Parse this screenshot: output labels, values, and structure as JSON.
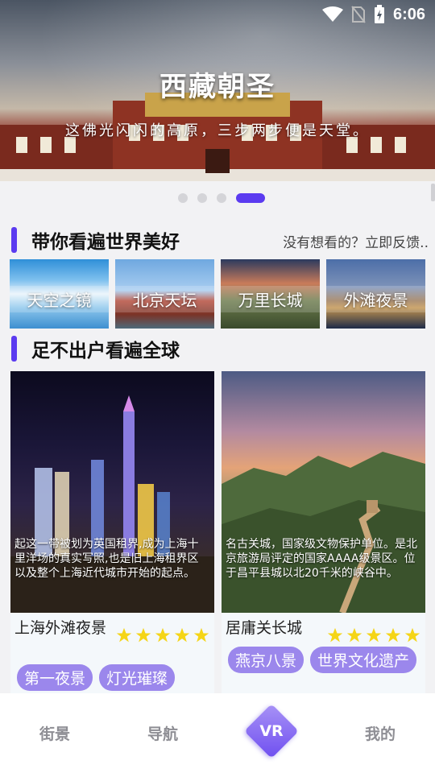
{
  "status_bar": {
    "time": "6:06"
  },
  "banner": {
    "title": "西藏朝圣",
    "subtitle": "这佛光闪闪的高原，三步两步便是天堂。",
    "page_count": 4,
    "active_page": 4
  },
  "section1": {
    "title": "带你看遍世界美好",
    "feedback": "没有想看的？立即反馈..",
    "items": [
      {
        "label": "天空之镜"
      },
      {
        "label": "北京天坛"
      },
      {
        "label": "万里长城"
      },
      {
        "label": "外滩夜景"
      }
    ]
  },
  "section2": {
    "title": "足不出户看遍全球",
    "cards": [
      {
        "name": "上海外滩夜景",
        "description": "起这一带被划为英国租界,成为上海十里洋场的真实写照,也是旧上海租界区以及整个上海近代城市开始的起点。",
        "rating": 5,
        "tags": [
          "第一夜景",
          "灯光璀璨"
        ]
      },
      {
        "name": "居庸关长城",
        "description": "名古关城，国家级文物保护单位。是北京旅游局评定的国家AAAA级景区。位于昌平县城以北20千米的峡谷中。",
        "rating": 5,
        "tags": [
          "燕京八景",
          "世界文化遗产"
        ]
      }
    ]
  },
  "bottom_nav": {
    "items": [
      {
        "label": "街景"
      },
      {
        "label": "导航"
      },
      {
        "label": "VR"
      },
      {
        "label": "我的"
      }
    ]
  },
  "colors": {
    "accent": "#5b3bf0",
    "tag": "#9b87ec",
    "star": "#f5d517"
  }
}
